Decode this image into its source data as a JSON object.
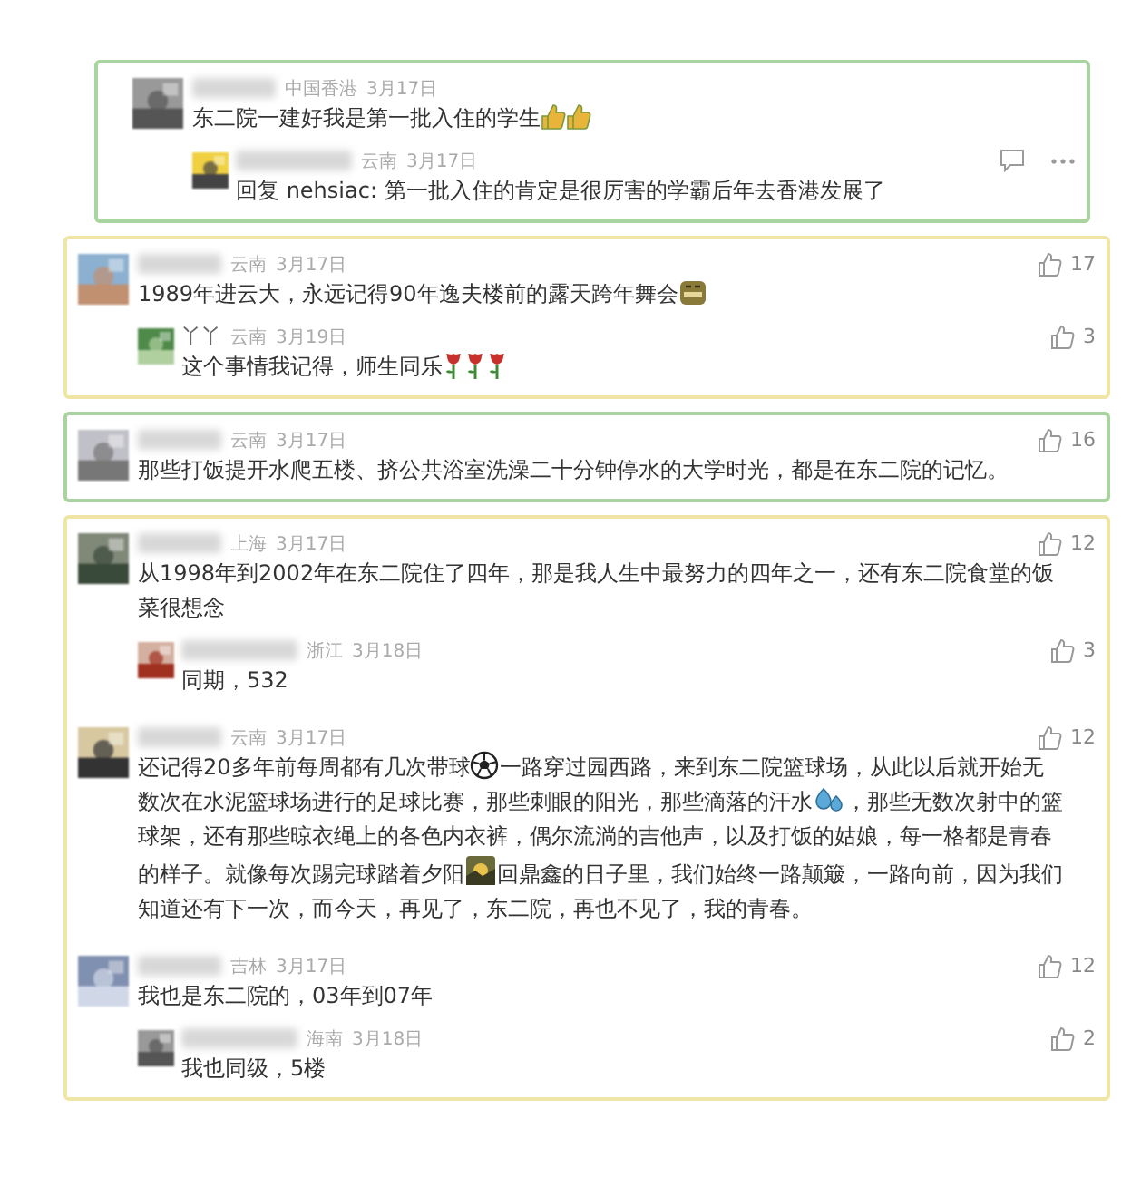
{
  "cards": [
    {
      "color": "#a9d49f",
      "comments": [
        {
          "location": "中国香港",
          "date": "3月17日",
          "body": [
            {
              "kind": "text",
              "text": "东二院一建好我是第一批入住的学生"
            },
            {
              "kind": "thumbs"
            },
            {
              "kind": "thumbs"
            }
          ],
          "replies": [
            {
              "location": "云南",
              "date": "3月17日",
              "show_menu": true,
              "body": [
                {
                  "kind": "text",
                  "text": "回复 nehsiac: 第一批入住的肯定是很厉害的学霸后年去香港发展了"
                }
              ]
            }
          ]
        }
      ]
    },
    {
      "color": "#efe6a6",
      "comments": [
        {
          "location": "云南",
          "date": "3月17日",
          "likes": "17",
          "body": [
            {
              "kind": "text",
              "text": "1989年进云大，永远记得90年逸夫楼前的露天跨年舞会"
            },
            {
              "kind": "grin"
            }
          ],
          "replies": [
            {
              "name": "丫丫",
              "location": "云南",
              "date": "3月19日",
              "likes": "3",
              "body": [
                {
                  "kind": "text",
                  "text": "这个事情我记得，师生同乐"
                },
                {
                  "kind": "rose"
                },
                {
                  "kind": "rose"
                },
                {
                  "kind": "rose"
                }
              ]
            }
          ]
        }
      ]
    },
    {
      "color": "#a9d49f",
      "comments": [
        {
          "location": "云南",
          "date": "3月17日",
          "likes": "16",
          "body": [
            {
              "kind": "text",
              "text": "那些打饭提开水爬五楼、挤公共浴室洗澡二十分钟停水的大学时光，都是在东二院的记忆。"
            }
          ]
        }
      ]
    },
    {
      "color": "#efe6a6",
      "comments": [
        {
          "location": "上海",
          "date": "3月17日",
          "likes": "12",
          "body": [
            {
              "kind": "text",
              "text": "从1998年到2002年在东二院住了四年，那是我人生中最努力的四年之一，还有东二院食堂的饭菜很想念"
            }
          ],
          "replies": [
            {
              "location": "浙江",
              "date": "3月18日",
              "likes": "3",
              "body": [
                {
                  "kind": "text",
                  "text": "同期，532"
                }
              ]
            }
          ]
        },
        {
          "location": "云南",
          "date": "3月17日",
          "likes": "12",
          "body": [
            {
              "kind": "text",
              "text": "还记得20多年前每周都有几次带球"
            },
            {
              "kind": "ball"
            },
            {
              "kind": "text",
              "text": "一路穿过园西路，来到东二院篮球场，从此以后就开始无"
            },
            {
              "kind": "break"
            },
            {
              "kind": "text",
              "text": "数次在水泥篮球场进行的足球比赛，那些刺眼的阳光，那些滴落的汗水"
            },
            {
              "kind": "drops"
            },
            {
              "kind": "text",
              "text": "，那些无数次射中的篮"
            },
            {
              "kind": "break"
            },
            {
              "kind": "text",
              "text": "球架，还有那些晾衣绳上的各色内衣裤，偶尔流淌的吉他声，以及打饭的姑娘，每一格都是青春"
            },
            {
              "kind": "break"
            },
            {
              "kind": "text",
              "text": "的样子。就像每次踢完球踏着夕阳"
            },
            {
              "kind": "sunset"
            },
            {
              "kind": "text",
              "text": "回鼎鑫的日子里，我们始终一路颠簸，一路向前，因为我们"
            },
            {
              "kind": "break"
            },
            {
              "kind": "text",
              "text": "知道还有下一次，而今天，再见了，东二院，再也不见了，我的青春。"
            }
          ]
        },
        {
          "location": "吉林",
          "date": "3月17日",
          "likes": "12",
          "body": [
            {
              "kind": "text",
              "text": "我也是东二院的，03年到07年"
            }
          ],
          "replies": [
            {
              "location": "海南",
              "date": "3月18日",
              "likes": "2",
              "body": [
                {
                  "kind": "text",
                  "text": "我也同级，5楼"
                }
              ]
            }
          ]
        }
      ]
    }
  ]
}
